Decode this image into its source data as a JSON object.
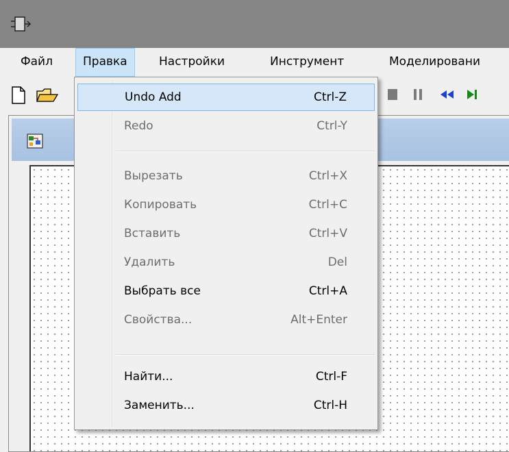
{
  "app": {
    "icon": "app-icon"
  },
  "menubar": {
    "items": [
      {
        "label": "Файл"
      },
      {
        "label": "Правка"
      },
      {
        "label": "Настройки"
      },
      {
        "label": "Инструмент"
      },
      {
        "label": "Моделировани"
      }
    ]
  },
  "toolbar": {
    "icons": [
      "new-document-icon",
      "open-folder-icon",
      "stop-icon",
      "pause-icon",
      "rewind-icon",
      "step-forward-icon"
    ]
  },
  "child_window": {
    "icon": "diagram-window-icon"
  },
  "edit_menu": {
    "items": [
      {
        "label": "Undo Add",
        "shortcut": "Ctrl-Z",
        "enabled": true,
        "highlighted": true
      },
      {
        "label": "Redo",
        "shortcut": "Ctrl-Y",
        "enabled": false
      },
      {
        "label": "Вырезать",
        "shortcut": "Ctrl+X",
        "enabled": false
      },
      {
        "label": "Копировать",
        "shortcut": "Ctrl+C",
        "enabled": false
      },
      {
        "label": "Вставить",
        "shortcut": "Ctrl+V",
        "enabled": false
      },
      {
        "label": "Удалить",
        "shortcut": "Del",
        "enabled": false
      },
      {
        "label": "Выбрать все",
        "shortcut": "Ctrl+A",
        "enabled": true
      },
      {
        "label": "Свойства...",
        "shortcut": "Alt+Enter",
        "enabled": false
      },
      {
        "label": "Найти...",
        "shortcut": "Ctrl-F",
        "enabled": true
      },
      {
        "label": "Заменить...",
        "shortcut": "Ctrl-H",
        "enabled": true
      }
    ]
  }
}
